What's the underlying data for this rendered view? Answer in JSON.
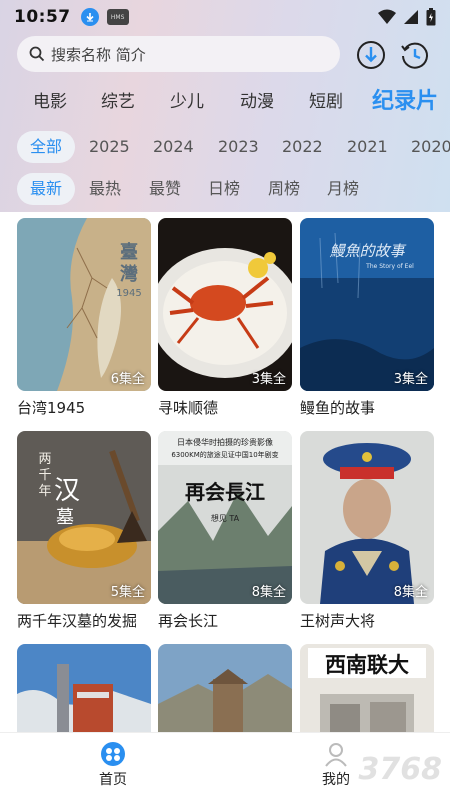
{
  "status": {
    "time": "10:57",
    "hms": "HMS"
  },
  "search": {
    "placeholder": "搜索名称 简介"
  },
  "categories": [
    "电影",
    "综艺",
    "少儿",
    "动漫",
    "短剧",
    "纪录片"
  ],
  "years": [
    "全部",
    "2025",
    "2024",
    "2023",
    "2022",
    "2021",
    "2020"
  ],
  "sorts": [
    "最新",
    "最热",
    "最赞",
    "日榜",
    "周榜",
    "月榜"
  ],
  "items": [
    {
      "title": "台湾1945",
      "badge": "6集全",
      "poster_text": "臺灣1945"
    },
    {
      "title": "寻味顺德",
      "badge": "3集全",
      "poster_text": ""
    },
    {
      "title": "鳗鱼的故事",
      "badge": "3集全",
      "poster_text": "鳗鱼的故事"
    },
    {
      "title": "两千年汉墓的发掘",
      "badge": "5集全",
      "poster_text": "两千年汉墓的发掘"
    },
    {
      "title": "再会长江",
      "badge": "8集全",
      "poster_text": "再会长江"
    },
    {
      "title": "王树声大将",
      "badge": "8集全",
      "poster_text": ""
    },
    {
      "title": "",
      "badge": "",
      "poster_text": ""
    },
    {
      "title": "",
      "badge": "",
      "poster_text": ""
    },
    {
      "title": "",
      "badge": "",
      "poster_text": "西南联大"
    }
  ],
  "nav": {
    "home": "首页",
    "mine": "我的"
  },
  "watermark": "3768",
  "colors": {
    "accent": "#2a8ff0"
  }
}
